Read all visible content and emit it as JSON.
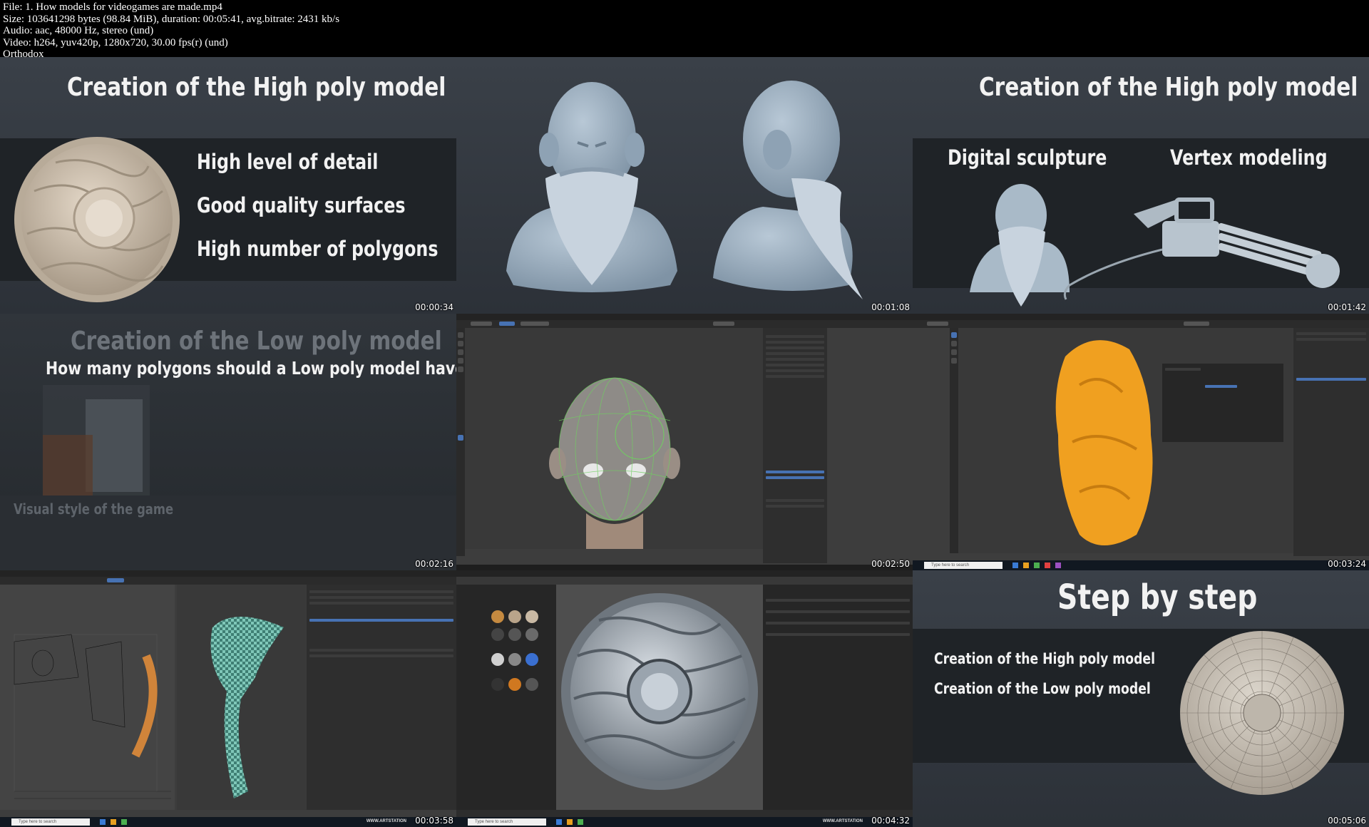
{
  "header": {
    "lines": [
      "File: 1. How models for videogames are made.mp4",
      "Size: 103641298 bytes (98.84 MiB), duration: 00:05:41, avg.bitrate: 2431 kb/s",
      "Audio: aac, 48000 Hz, stereo (und)",
      "Video: h264, yuv420p, 1280x720, 30.00 fps(r) (und)",
      "Orthodox"
    ]
  },
  "tiles": [
    {
      "timestamp": "00:00:34",
      "title": "Creation of the High poly model",
      "bullets": [
        "High level of detail",
        "Good quality surfaces",
        "High number of polygons"
      ],
      "image": "wooden-shield-sculpt"
    },
    {
      "timestamp": "00:01:08",
      "image": "dwarf-bust-sculpt-front-and-side"
    },
    {
      "timestamp": "00:01:42",
      "title": "Creation of the High poly model",
      "labels": [
        "Digital sculpture",
        "Vertex modeling"
      ],
      "image": "dwarf-and-gatling-gun"
    },
    {
      "timestamp": "00:02:16",
      "title": "Creation of the Low poly model",
      "subtitle": "How many polygons should a Low poly model have?",
      "footer": "Visual style of the game",
      "image": "character-references"
    },
    {
      "timestamp": "00:02:50",
      "app": "blender",
      "image": "head-retopology"
    },
    {
      "timestamp": "00:03:24",
      "app": "blender",
      "image": "orange-rock-sculpt",
      "search_placeholder": "Type here to search"
    },
    {
      "timestamp": "00:03:58",
      "app": "blender",
      "image": "axe-uv-unwrap",
      "search_placeholder": "Type here to search",
      "watermark": "WWW.ARTSTATION"
    },
    {
      "timestamp": "00:04:32",
      "app": "substance-painter",
      "image": "metal-shield-texture",
      "search_placeholder": "Type here to search",
      "watermark": "WWW.ARTSTATION"
    },
    {
      "timestamp": "00:05:06",
      "title": "Step by step",
      "bullets": [
        "Creation of the High poly model",
        "Creation of the Low poly model"
      ],
      "image": "wireframe-shield"
    }
  ],
  "colors": {
    "slide_bg": "#353b42",
    "band": "#1f2327",
    "blender_ui": "#3d3d3d",
    "highlight": "#4772b3",
    "rock": "#f0a020",
    "uv_teal": "#7fc7b8"
  }
}
